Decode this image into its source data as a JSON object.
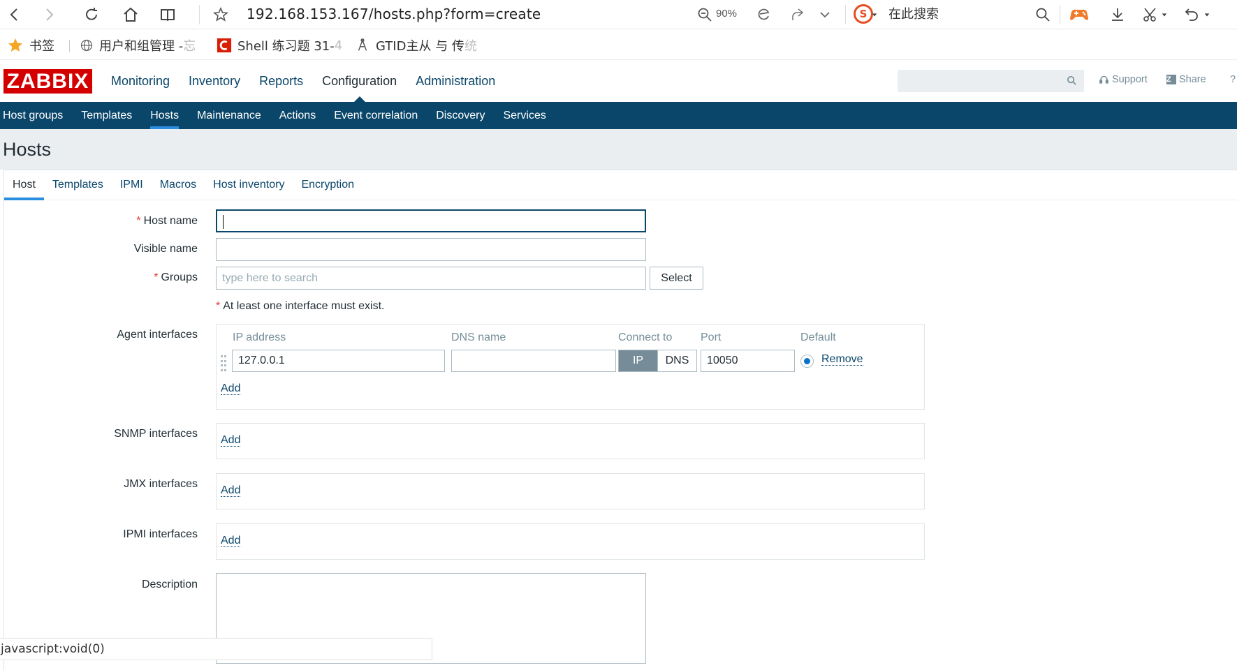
{
  "browser": {
    "url": "192.168.153.167/hosts.php?form=create",
    "zoom": "90%",
    "search_label": "在此搜索",
    "search_engine_glyph": "S",
    "bookmarks": [
      {
        "label": "书签",
        "icon": "star-icon"
      },
      {
        "label": "用户和组管理 - ",
        "fade": "忘",
        "icon": "globe-icon"
      },
      {
        "label": "Shell 练习题 31-",
        "fade": "4",
        "icon": "csdn-icon"
      },
      {
        "label": "GTID主从 与 传",
        "fade": "统",
        "icon": "tool-icon"
      }
    ],
    "status_text": "javascript:void(0)"
  },
  "header": {
    "logo": "ZABBIX",
    "menu": [
      "Monitoring",
      "Inventory",
      "Reports",
      "Configuration",
      "Administration"
    ],
    "active_menu": "Configuration",
    "support": "Support",
    "share": "Share",
    "share_badge": "Z",
    "help": "?"
  },
  "subnav": {
    "items": [
      "Host groups",
      "Templates",
      "Hosts",
      "Maintenance",
      "Actions",
      "Event correlation",
      "Discovery",
      "Services"
    ],
    "active": "Hosts"
  },
  "page": {
    "title": "Hosts"
  },
  "tabs": {
    "items": [
      "Host",
      "Templates",
      "IPMI",
      "Macros",
      "Host inventory",
      "Encryption"
    ],
    "active": "Host"
  },
  "form": {
    "required_mark": "*",
    "host_name_label": "Host name",
    "host_name_value": "",
    "visible_name_label": "Visible name",
    "visible_name_value": "",
    "groups_label": "Groups",
    "groups_placeholder": "type here to search",
    "select_button": "Select",
    "interface_note": "At least one interface must exist.",
    "agent_label": "Agent interfaces",
    "columns": {
      "ip": "IP address",
      "dns": "DNS name",
      "connect": "Connect to",
      "port": "Port",
      "default": "Default"
    },
    "agent_row": {
      "ip": "127.0.0.1",
      "dns": "",
      "connect_ip": "IP",
      "connect_dns": "DNS",
      "port": "10050",
      "default_selected": true,
      "remove": "Remove"
    },
    "add": "Add",
    "snmp_label": "SNMP interfaces",
    "jmx_label": "JMX interfaces",
    "ipmi_label": "IPMI interfaces",
    "description_label": "Description",
    "description_value": ""
  }
}
